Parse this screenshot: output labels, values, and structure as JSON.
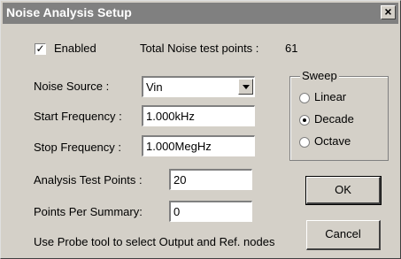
{
  "window": {
    "title": "Noise Analysis Setup",
    "close_glyph": "×"
  },
  "enabled": {
    "label": "Enabled",
    "checked": true,
    "check_glyph": "✓"
  },
  "total_points": {
    "label": "Total Noise test points :",
    "value": "61"
  },
  "noise_source": {
    "label": "Noise Source :",
    "value": "Vin"
  },
  "start_frequency": {
    "label": "Start Frequency :",
    "value": "1.000kHz"
  },
  "stop_frequency": {
    "label": "Stop Frequency :",
    "value": "1.000MegHz"
  },
  "analysis_test_points": {
    "label": "Analysis Test Points :",
    "value": "20"
  },
  "points_per_summary": {
    "label": "Points Per Summary:",
    "value": "0"
  },
  "sweep": {
    "title": "Sweep",
    "options": [
      "Linear",
      "Decade",
      "Octave"
    ],
    "selected": "Decade"
  },
  "buttons": {
    "ok": "OK",
    "cancel": "Cancel"
  },
  "hint": "Use Probe tool to select Output and Ref. nodes",
  "colors": {
    "face": "#d4d0c8",
    "titlebar": "#808080"
  }
}
